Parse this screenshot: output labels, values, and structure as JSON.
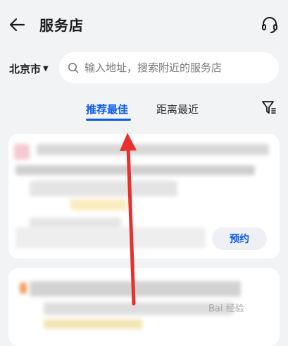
{
  "header": {
    "title": "服务店",
    "back_icon": "arrow-left-icon",
    "support_icon": "headset-icon"
  },
  "location": {
    "city": "北京市",
    "caret_icon": "caret-down-icon"
  },
  "search": {
    "placeholder": "输入地址，搜索附近的服务店",
    "value": ""
  },
  "tabs": [
    {
      "label": "推荐最佳",
      "active": true
    },
    {
      "label": "距离最近",
      "active": false
    }
  ],
  "filter_icon": "filter-icon",
  "cards": [
    {
      "action_label": "预约"
    }
  ],
  "colors": {
    "accent": "#0a59f7",
    "background": "#f1f3f5",
    "annotation_arrow": "#e8302f"
  },
  "watermark": "Bai 经验"
}
